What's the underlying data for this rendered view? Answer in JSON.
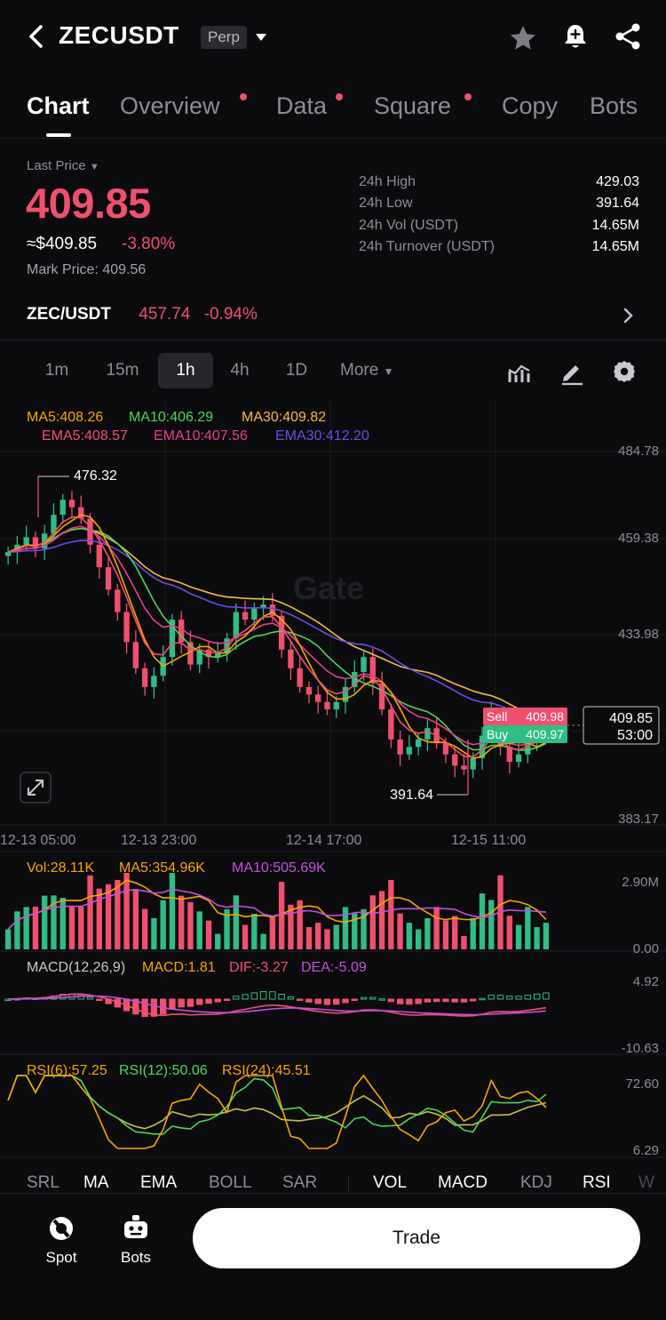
{
  "header": {
    "symbol": "ZECUSDT",
    "market_type": "Perp"
  },
  "tabs": [
    {
      "label": "Chart",
      "active": true,
      "dot": false
    },
    {
      "label": "Overview",
      "active": false,
      "dot": true
    },
    {
      "label": "Data",
      "active": false,
      "dot": true
    },
    {
      "label": "Square",
      "active": false,
      "dot": true
    },
    {
      "label": "Copy",
      "active": false,
      "dot": false
    },
    {
      "label": "Bots",
      "active": false,
      "dot": false
    }
  ],
  "price": {
    "last_price_label": "Last Price",
    "last_price": "409.85",
    "usd_price": "≈$409.85",
    "change_pct": "-3.80%",
    "mark_price": "Mark Price:  409.56",
    "stats": [
      {
        "label": "24h High",
        "value": "429.03"
      },
      {
        "label": "24h Low",
        "value": "391.64"
      },
      {
        "label": "24h Vol (USDT)",
        "value": "14.65M"
      },
      {
        "label": "24h Turnover (USDT)",
        "value": "14.65M"
      }
    ]
  },
  "spot": {
    "pair": "ZEC/USDT",
    "price": "457.74",
    "change": "-0.94%"
  },
  "intervals": [
    {
      "label": "1m",
      "active": false
    },
    {
      "label": "15m",
      "active": false
    },
    {
      "label": "1h",
      "active": true
    },
    {
      "label": "4h",
      "active": false
    },
    {
      "label": "1D",
      "active": false
    },
    {
      "label": "More",
      "active": false
    }
  ],
  "indicator_tabs": {
    "main": [
      "SRL",
      "MA",
      "EMA",
      "BOLL",
      "SAR"
    ],
    "sub": [
      "VOL",
      "MACD",
      "KDJ",
      "RSI",
      "W"
    ],
    "on": [
      "MA",
      "EMA",
      "VOL",
      "MACD",
      "RSI"
    ]
  },
  "bottom": {
    "spot_label": "Spot",
    "bots_label": "Bots",
    "trade_label": "Trade"
  },
  "colors": {
    "up": "#2ebd85",
    "down": "#f0506e",
    "ma5": "#f7a600",
    "ma10": "#4bd65a",
    "ma30": "#f7b84b",
    "ema5": "#f0506e",
    "ema10": "#e83e8c",
    "ema30": "#6b4ee6",
    "dif": "#d64fbd",
    "dea": "#c73ea8"
  },
  "chart_data": {
    "type": "candlestick",
    "watermark": "Gate",
    "main_legend_ma": [
      {
        "name": "MA5",
        "value": "408.26"
      },
      {
        "name": "MA10",
        "value": "406.29"
      },
      {
        "name": "MA30",
        "value": "409.82"
      }
    ],
    "main_legend_ema": [
      {
        "name": "EMA5",
        "value": "408.57"
      },
      {
        "name": "EMA10",
        "value": "407.56"
      },
      {
        "name": "EMA30",
        "value": "412.20"
      }
    ],
    "y_ticks": [
      "484.78",
      "459.38",
      "433.98",
      "409.85",
      "383.17"
    ],
    "x_ticks": [
      "12-13 05:00",
      "12-13 23:00",
      "12-14 17:00",
      "12-15 11:00"
    ],
    "ylim": [
      383.17,
      484.78
    ],
    "high_marker": "476.32",
    "low_marker": "391.64",
    "current_price": "409.85",
    "countdown": "53:00",
    "sell": {
      "label": "Sell",
      "price": "409.98"
    },
    "buy": {
      "label": "Buy",
      "price": "409.97"
    },
    "close_series": [
      456,
      458,
      460,
      457,
      461,
      466,
      470,
      468,
      465,
      458,
      452,
      446,
      440,
      432,
      425,
      420,
      423,
      428,
      438,
      432,
      426,
      430,
      428,
      429,
      433,
      440,
      438,
      441,
      442,
      439,
      430,
      425,
      420,
      418,
      416,
      414,
      416,
      420,
      424,
      428,
      421,
      414,
      406,
      402,
      404,
      406,
      409,
      405,
      402,
      399,
      398,
      401,
      407,
      413,
      404,
      400,
      402,
      406,
      408,
      410
    ],
    "volume_legend": [
      {
        "name": "Vol",
        "value": "28.11K"
      },
      {
        "name": "MA5",
        "value": "354.96K"
      },
      {
        "name": "MA10",
        "value": "505.69K"
      }
    ],
    "volume_ticks": [
      "2.90M",
      "0.00"
    ],
    "macd_legend": [
      {
        "name": "MACD(12,26,9)",
        "value": ""
      },
      {
        "name": "MACD",
        "value": "1.81"
      },
      {
        "name": "DIF",
        "value": "-3.27"
      },
      {
        "name": "DEA",
        "value": "-5.09"
      }
    ],
    "macd_ticks": [
      "4.92",
      "-10.63"
    ],
    "rsi_legend": [
      {
        "name": "RSI(6)",
        "value": "57.25"
      },
      {
        "name": "RSI(12)",
        "value": "50.06"
      },
      {
        "name": "RSI(24)",
        "value": "45.51"
      }
    ],
    "rsi_ticks": [
      "72.60",
      "6.29"
    ]
  }
}
